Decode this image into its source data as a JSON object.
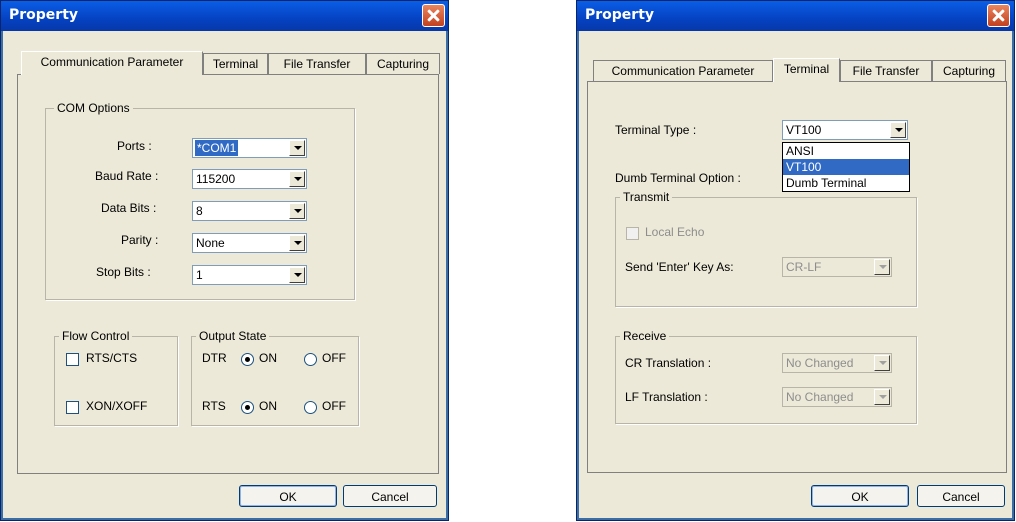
{
  "left": {
    "title": "Property",
    "tabs": [
      "Communication Parameter",
      "Terminal",
      "File Transfer",
      "Capturing"
    ],
    "com_options": {
      "legend": "COM Options",
      "ports_label": "Ports :",
      "ports_value": "*COM1",
      "baud_label": "Baud Rate :",
      "baud_value": "115200",
      "databits_label": "Data Bits :",
      "databits_value": "8",
      "parity_label": "Parity :",
      "parity_value": "None",
      "stopbits_label": "Stop Bits :",
      "stopbits_value": "1"
    },
    "flow_control": {
      "legend": "Flow Control",
      "rts_cts": "RTS/CTS",
      "xon_xoff": "XON/XOFF"
    },
    "output_state": {
      "legend": "Output State",
      "dtr": "DTR",
      "rts": "RTS",
      "on": "ON",
      "off": "OFF"
    },
    "ok": "OK",
    "cancel": "Cancel"
  },
  "right": {
    "title": "Property",
    "tabs": [
      "Communication Parameter",
      "Terminal",
      "File Transfer",
      "Capturing"
    ],
    "terminal_type_label": "Terminal Type :",
    "terminal_type_value": "VT100",
    "dropdown_options": [
      "ANSI",
      "VT100",
      "Dumb Terminal"
    ],
    "dumb_terminal_label": "Dumb Terminal Option :",
    "transmit": {
      "legend": "Transmit",
      "local_echo": "Local Echo",
      "send_enter_label": "Send 'Enter' Key As:",
      "send_enter_value": "CR-LF"
    },
    "receive": {
      "legend": "Receive",
      "cr_label": "CR Translation :",
      "cr_value": "No Changed",
      "lf_label": "LF Translation :",
      "lf_value": "No Changed"
    },
    "ok": "OK",
    "cancel": "Cancel"
  },
  "colors": {
    "title_bar": "#0542c2",
    "face": "#ece9d8",
    "selection": "#316ac5",
    "close": "#c2401f"
  }
}
